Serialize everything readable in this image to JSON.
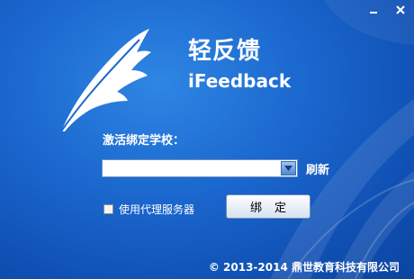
{
  "window": {
    "minimize_icon": "minimize-icon",
    "close_icon": "close-icon"
  },
  "app": {
    "title": "轻反馈",
    "subtitle": "iFeedback",
    "logo_icon": "feather-icon"
  },
  "form": {
    "school_label": "激活绑定学校：",
    "school_value": "",
    "dropdown_icon": "chevron-down-icon",
    "refresh_label": "刷新",
    "proxy_label": "使用代理服务器",
    "proxy_checked": false,
    "bind_label": "绑定"
  },
  "footer": {
    "copyright": "© 2013-2014 鼎世教育科技有限公司"
  },
  "colors": {
    "background": "#1b68cf",
    "text": "#ffffff",
    "accent": "#4f88d4"
  }
}
